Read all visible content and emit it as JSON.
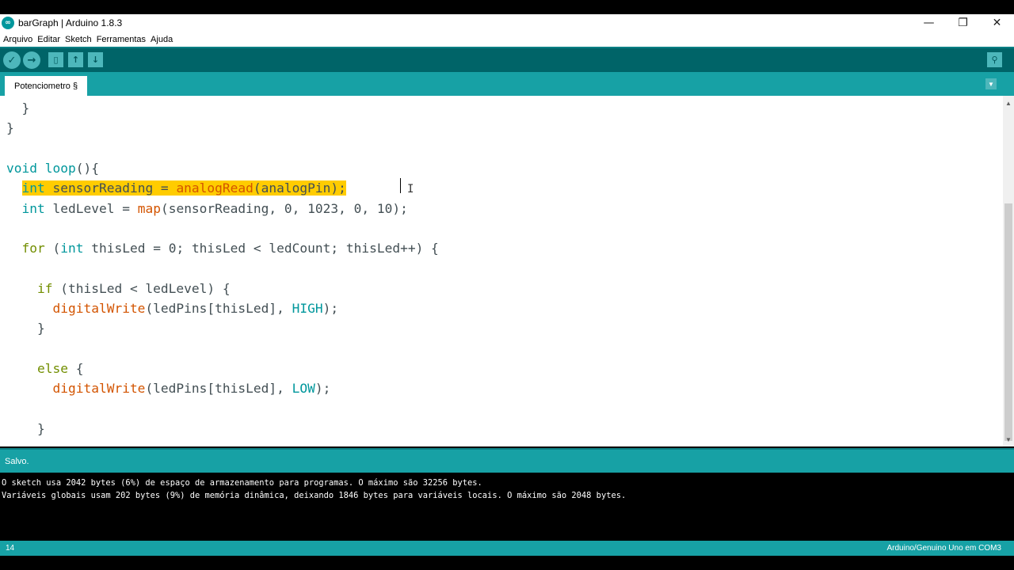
{
  "window": {
    "title": "barGraph | Arduino 1.8.3",
    "logo_glyph": "∞",
    "minimize_glyph": "—",
    "maximize_glyph": "❐",
    "close_glyph": "✕"
  },
  "menu": [
    "Arquivo",
    "Editar",
    "Sketch",
    "Ferramentas",
    "Ajuda"
  ],
  "toolbar": {
    "verify_icon": "check-icon",
    "upload_icon": "arrow-right-icon",
    "new_icon": "document-icon",
    "open_icon": "arrow-up-icon",
    "save_icon": "arrow-down-icon",
    "serial_monitor_icon": "magnifier-icon",
    "verify_glyph": "✓",
    "upload_glyph": "→",
    "new_glyph": "▯",
    "open_glyph": "↑",
    "save_glyph": "↓",
    "serial_glyph": "⚲"
  },
  "tabs": [
    {
      "label": "Potenciometro §",
      "active": true
    }
  ],
  "tab_menu_glyph": "▼",
  "code": [
    [
      {
        "t": "  }"
      }
    ],
    [
      {
        "t": "}"
      }
    ],
    [],
    [
      {
        "t": "void",
        "c": "kw"
      },
      {
        "t": " "
      },
      {
        "t": "loop",
        "c": "kw"
      },
      {
        "t": "(){"
      }
    ],
    [
      {
        "t": "  "
      },
      {
        "t": "int",
        "c": "kw",
        "s": 1
      },
      {
        "t": " sensorReading = ",
        "s": 1
      },
      {
        "t": "analogRead",
        "c": "fn",
        "s": 1
      },
      {
        "t": "(analogPin);",
        "s": 1
      }
    ],
    [
      {
        "t": "  "
      },
      {
        "t": "int",
        "c": "kw"
      },
      {
        "t": " ledLevel = "
      },
      {
        "t": "map",
        "c": "fn"
      },
      {
        "t": "(sensorReading, 0, 1023, 0, 10);"
      }
    ],
    [],
    [
      {
        "t": "  "
      },
      {
        "t": "for",
        "c": "ctl"
      },
      {
        "t": " ("
      },
      {
        "t": "int",
        "c": "kw"
      },
      {
        "t": " thisLed = 0; thisLed < ledCount; thisLed++) {"
      }
    ],
    [],
    [
      {
        "t": "    "
      },
      {
        "t": "if",
        "c": "ctl"
      },
      {
        "t": " (thisLed < ledLevel) {"
      }
    ],
    [
      {
        "t": "      "
      },
      {
        "t": "digitalWrite",
        "c": "fn"
      },
      {
        "t": "(ledPins[thisLed], "
      },
      {
        "t": "HIGH",
        "c": "cst"
      },
      {
        "t": ");"
      }
    ],
    [
      {
        "t": "    }"
      }
    ],
    [],
    [
      {
        "t": "    "
      },
      {
        "t": "else",
        "c": "ctl"
      },
      {
        "t": " {"
      }
    ],
    [
      {
        "t": "      "
      },
      {
        "t": "digitalWrite",
        "c": "fn"
      },
      {
        "t": "(ledPins[thisLed], "
      },
      {
        "t": "LOW",
        "c": "cst"
      },
      {
        "t": ");"
      }
    ],
    [],
    [
      {
        "t": "    }"
      }
    ]
  ],
  "status": {
    "message": "Salvo."
  },
  "console": [
    "O sketch usa 2042 bytes (6%) de espaço de armazenamento para programas. O máximo são 32256 bytes.",
    "Variáveis globais usam 202 bytes (9%) de memória dinâmica, deixando 1846 bytes para variáveis locais. O máximo são 2048 bytes."
  ],
  "footer": {
    "line_number": "14",
    "board": "Arduino/Genuino Uno em COM3"
  },
  "scrollbar": {
    "up_glyph": "▲",
    "down_glyph": "▼"
  }
}
